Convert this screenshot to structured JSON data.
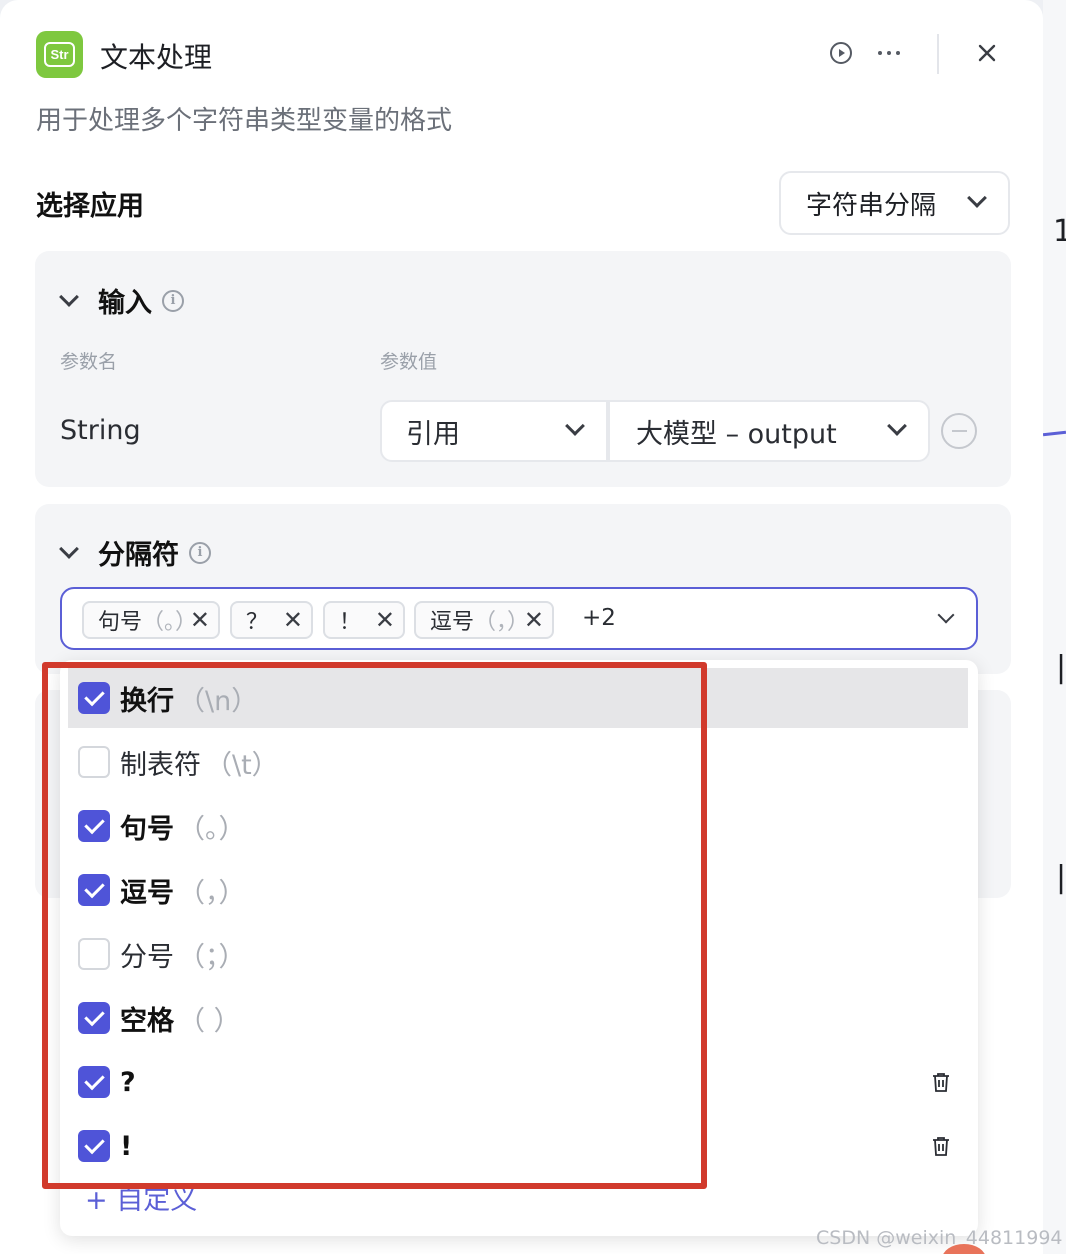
{
  "header": {
    "app_icon_text": "Str",
    "title": "文本处理",
    "run_icon": "play-circle-icon",
    "more_icon": "ellipsis-icon",
    "close_icon": "close-icon",
    "description": "用于处理多个字符串类型变量的格式"
  },
  "app_select": {
    "label": "选择应用",
    "value": "字符串分隔"
  },
  "input_section": {
    "title": "输入",
    "col_name": "参数名",
    "col_value": "参数值",
    "param_name": "String",
    "ref_type": "引用",
    "ref_value": "大模型 – output"
  },
  "separator_section": {
    "title": "分隔符",
    "tags": [
      {
        "label": "句号",
        "hint": "（。）"
      },
      {
        "label": "？",
        "hint": ""
      },
      {
        "label": "！",
        "hint": ""
      },
      {
        "label": "逗号",
        "hint": "（，）"
      }
    ],
    "more": "+2"
  },
  "options": [
    {
      "label": "换行",
      "hint": "（\\n）",
      "checked": true
    },
    {
      "label": "制表符",
      "hint": "（\\t）",
      "checked": false
    },
    {
      "label": "句号",
      "hint": "（。）",
      "checked": true
    },
    {
      "label": "逗号",
      "hint": "（，）",
      "checked": true
    },
    {
      "label": "分号",
      "hint": "（；）",
      "checked": false
    },
    {
      "label": "空格",
      "hint": "（ ）",
      "checked": true
    },
    {
      "label": "?",
      "hint": "",
      "checked": true
    },
    {
      "label": "!",
      "hint": "",
      "checked": true
    }
  ],
  "custom_label": "+ 自定义",
  "watermark": "CSDN @weixin_44811994",
  "colors": {
    "accent": "#5b5fd6",
    "checkbox": "#4f54d8",
    "annotation_red": "#d13a2c",
    "app_icon_green": "#7ec83f"
  }
}
